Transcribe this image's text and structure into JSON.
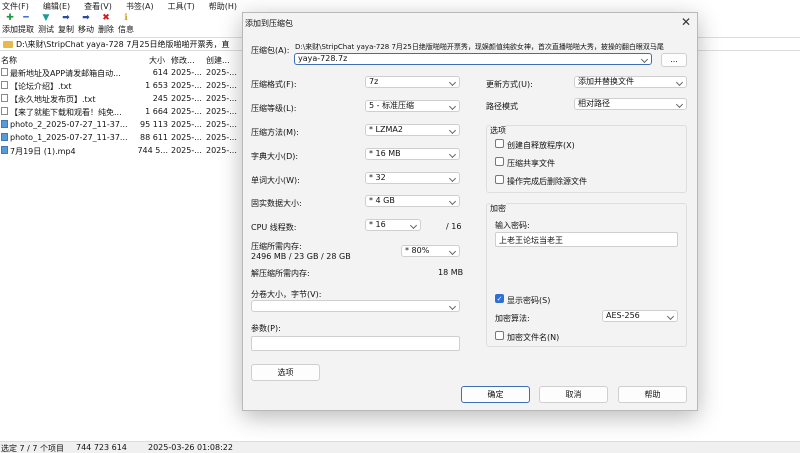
{
  "menu": [
    "文件(F)",
    "编辑(E)",
    "查看(V)",
    "书签(A)",
    "工具(T)",
    "帮助(H)"
  ],
  "toolbar": [
    {
      "label": "添加",
      "icon": "add-icon",
      "glyph": "✚",
      "color": "#1a9c3a"
    },
    {
      "label": "提取",
      "icon": "extract-icon",
      "glyph": "━",
      "color": "#3a6fd1"
    },
    {
      "label": "测试",
      "icon": "test-icon",
      "glyph": "▼",
      "color": "#1a9c9c"
    },
    {
      "label": "复制",
      "icon": "copy-icon",
      "glyph": "➡",
      "color": "#2a4a9c"
    },
    {
      "label": "移动",
      "icon": "move-icon",
      "glyph": "➡",
      "color": "#2a4a9c"
    },
    {
      "label": "删除",
      "icon": "delete-icon",
      "glyph": "✖",
      "color": "#d11a1a"
    },
    {
      "label": "信息",
      "icon": "info-icon",
      "glyph": "ℹ",
      "color": "#c9a21a"
    }
  ],
  "path": "D:\\来财\\StripChat yaya-728 7月25日绝版啪啪开票秀，直",
  "columns": {
    "name": "名称",
    "size": "大小",
    "modified": "修改...",
    "created": "创建..."
  },
  "files": [
    {
      "name": "最新地址及APP请发邮箱自动...",
      "size": "614",
      "modified": "2025-...",
      "created": "2025-...",
      "type": "text"
    },
    {
      "name": "【论坛介绍】.txt",
      "size": "1 653",
      "modified": "2025-...",
      "created": "2025-...",
      "type": "text"
    },
    {
      "name": "【永久地址发布页】.txt",
      "size": "245",
      "modified": "2025-...",
      "created": "2025-...",
      "type": "text"
    },
    {
      "name": "【来了就能下载和观看！纯免...",
      "size": "1 664",
      "modified": "2025-...",
      "created": "2025-...",
      "type": "text"
    },
    {
      "name": "photo_2_2025-07-27_11-37...",
      "size": "95 113",
      "modified": "2025-...",
      "created": "2025-...",
      "type": "image"
    },
    {
      "name": "photo_1_2025-07-27_11-37...",
      "size": "88 611",
      "modified": "2025-...",
      "created": "2025-...",
      "type": "image"
    },
    {
      "name": "7月19日 (1).mp4",
      "size": "744 5...",
      "modified": "2025-...",
      "created": "2025-...",
      "type": "image"
    }
  ],
  "status": {
    "selected": "选定 7 / 7 个项目",
    "total": "744 723 614",
    "date": "2025-03-26 01:08:22"
  },
  "dialog": {
    "title": "添加到压缩包",
    "archive_label": "压缩包(A):",
    "archive_dir": "D:\\来财\\StripChat yaya-728 7月25日绝版啪啪开票秀，现娱颜值纯欲女神，首次直播啪啪大秀，披操的翻白眼双马尾",
    "archive_name": "yaya-728.7z",
    "browse_label": "...",
    "format_label": "压缩格式(F):",
    "format_value": "7z",
    "level_label": "压缩等级(L):",
    "level_value": "5 - 标准压缩",
    "method_label": "压缩方法(M):",
    "method_value": "* LZMA2",
    "dict_label": "字典大小(D):",
    "dict_value": "* 16 MB",
    "word_label": "单词大小(W):",
    "word_value": "* 32",
    "solid_label": "固实数据大小:",
    "solid_value": "* 4 GB",
    "threads_label": "CPU 线程数:",
    "threads_value": "* 16",
    "threads_max": "/ 16",
    "mem_label": "压缩所需内存:",
    "mem_value": "2496 MB / 23 GB / 28 GB",
    "mem_percent": "* 80%",
    "decomp_label": "解压缩所需内存:",
    "decomp_value": "18 MB",
    "split_label": "分卷大小，字节(V):",
    "split_value": "",
    "params_label": "参数(P):",
    "params_value": "",
    "options_button": "选项",
    "update_label": "更新方式(U):",
    "update_value": "添加并替换文件",
    "pathmode_label": "路径模式",
    "pathmode_value": "相对路径",
    "options_group": "选项",
    "opt_sfx": "创建自释放程序(X)",
    "opt_shared": "压缩共享文件",
    "opt_delete": "操作完成后删除源文件",
    "encrypt_group": "加密",
    "password_label": "输入密码:",
    "password_value": "上老王论坛当老王",
    "show_password": "显示密码(S)",
    "enc_method_label": "加密算法:",
    "enc_method_value": "AES-256",
    "encrypt_names": "加密文件名(N)",
    "ok": "确定",
    "cancel": "取消",
    "help": "帮助"
  }
}
